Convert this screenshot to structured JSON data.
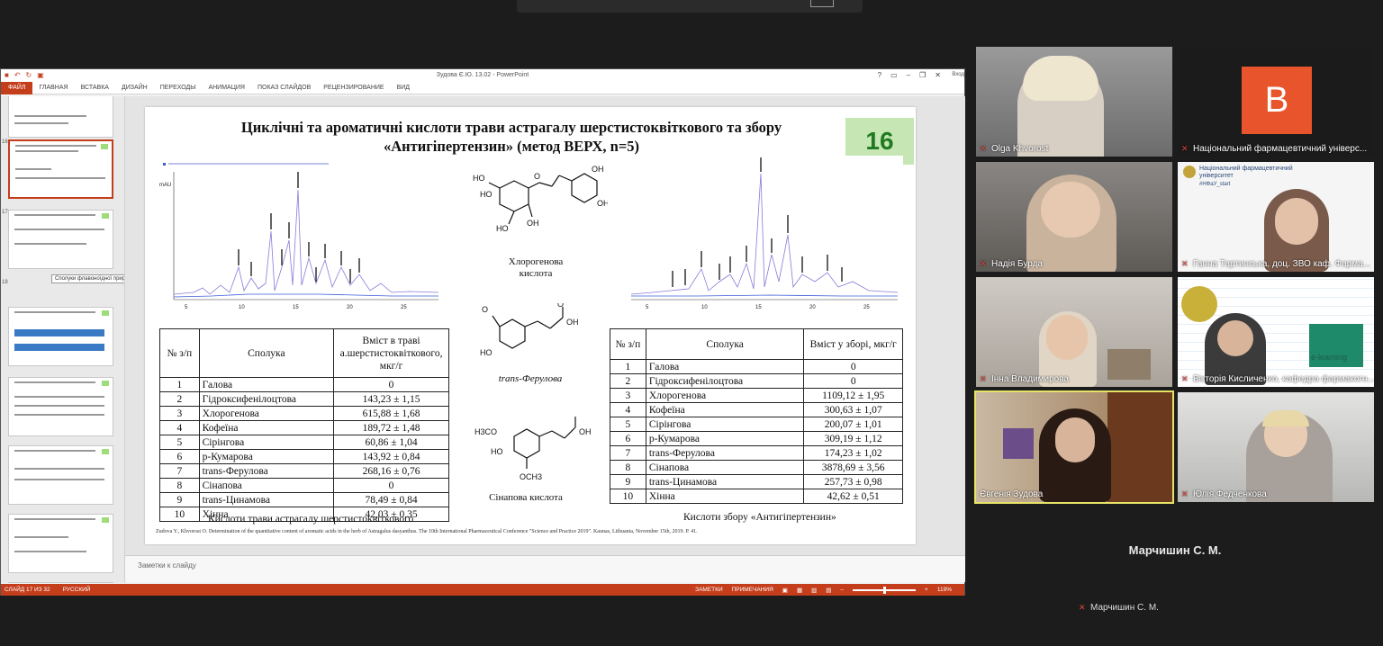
{
  "powerpoint": {
    "window_title": "Зудова Є.Ю. 13.02 - PowerPoint",
    "ribbon_tabs": [
      "ФАЙЛ",
      "ГЛАВНАЯ",
      "ВСТАВКА",
      "ДИЗАЙН",
      "ПЕРЕХОДЫ",
      "АНИМАЦИЯ",
      "ПОКАЗ СЛАЙДОВ",
      "РЕЦЕНЗИРОВАНИЕ",
      "ВИД"
    ],
    "user_label": "Вход",
    "thumbnail_tooltip": "Сполуки флавоноїдної приро...",
    "notes_placeholder": "Заметки к слайду",
    "status": {
      "slide_counter": "СЛАЙД 17 ИЗ 32",
      "language": "РУССКИЙ",
      "notes_button": "ЗАМЕТКИ",
      "comments_button": "ПРИМЕЧАНИЯ",
      "zoom": "119%"
    }
  },
  "slide": {
    "title_line1": "Циклічні та ароматичні кислоти трави астрагалу шерстистоквіткового та збору",
    "title_line2": "«Антигіпертензин» (метод ВЕРХ, n=5)",
    "number": "16",
    "chem": {
      "chlorogenic": "Хлорогенова кислота",
      "ferulic": "trans-Ферулова",
      "sinapic": "Сінапова кислота"
    },
    "table_left": {
      "headers": [
        "№ з/п",
        "Сполука",
        "Вміст в траві а.шерстистоквіткового, мкг/г"
      ],
      "rows": [
        [
          "1",
          "Галова",
          "0"
        ],
        [
          "2",
          "Гідроксифенілоцтова",
          "143,23 ± 1,15"
        ],
        [
          "3",
          "Хлорогенова",
          "615,88 ± 1,68"
        ],
        [
          "4",
          "Кофеїна",
          "189,72 ± 1,48"
        ],
        [
          "5",
          "Сірінгова",
          "60,86 ± 1,04"
        ],
        [
          "6",
          "p-Кумарова",
          "143,92 ± 0,84"
        ],
        [
          "7",
          "trans-Ферулова",
          "268,16 ± 0,76"
        ],
        [
          "8",
          "Сінапова",
          "0"
        ],
        [
          "9",
          "trans-Цинамова",
          "78,49 ± 0,84"
        ],
        [
          "10",
          "Хінна",
          "42,03 ± 0,35"
        ]
      ],
      "caption": "Кислоти трави астрагалу шерстистоквіткового"
    },
    "table_right": {
      "headers": [
        "№ з/п",
        "Сполука",
        "Вміст у зборі, мкг/г"
      ],
      "rows": [
        [
          "1",
          "Галова",
          "0"
        ],
        [
          "2",
          "Гідроксифенілоцтова",
          "0"
        ],
        [
          "3",
          "Хлорогенова",
          "1109,12 ± 1,95"
        ],
        [
          "4",
          "Кофеїна",
          "300,63 ± 1,07"
        ],
        [
          "5",
          "Сірінгова",
          "200,07 ± 1,01"
        ],
        [
          "6",
          "p-Кумарова",
          "309,19 ± 1,12"
        ],
        [
          "7",
          "trans-Ферулова",
          "174,23 ± 1,02"
        ],
        [
          "8",
          "Сінапова",
          "3878,69 ± 3,56"
        ],
        [
          "9",
          "trans-Цинамова",
          "257,73 ± 0,98"
        ],
        [
          "10",
          "Хінна",
          "42,62 ± 0,51"
        ]
      ],
      "caption": "Кислоти збору «Антигіпертензин»"
    },
    "reference": "Zudova Y., Khvorost O. Determination of the quantitative content of aromatic acids in the herb of Astragalus dasyanthus. The 10th International Pharmaceutical Conference \"Science and Practice 2019\". Kaunas, Lithuania, November 15th, 2019. P. 41."
  },
  "participants": [
    {
      "name": "Olga Khvorost"
    },
    {
      "name": "Національний фармацевтичний універс...",
      "avatar_letter": "В",
      "avatar_color": "#e8542b"
    },
    {
      "name": "Надія Бурда"
    },
    {
      "name": "Ганна Тартинська, доц. ЗВО каф. Фарма..."
    },
    {
      "name": "Інна Владимирова"
    },
    {
      "name": "Вікторія Кисличенко, кафедра фармакогн..."
    },
    {
      "name": "Євгенія Зудова",
      "active": true
    },
    {
      "name": "Юлія Федченкова"
    }
  ],
  "extra_participant": {
    "name": "Марчишин С. М."
  },
  "tile_overlays": {
    "university_logo_text": "Національний фармацевтичний університет",
    "hashtag": "#НФаУ_start",
    "elearning": "e-learning"
  }
}
